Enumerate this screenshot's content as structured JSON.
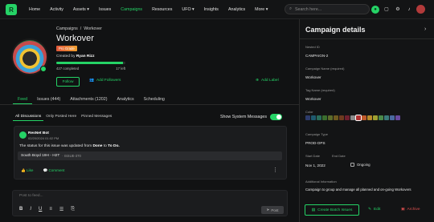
{
  "topbar": {
    "logo": "R",
    "nav": [
      "Home",
      "Activity",
      "Assets ▾",
      "Issues",
      "Campaigns",
      "Resources",
      "UFO ▾",
      "Insights",
      "Analytics",
      "More ▾"
    ],
    "active_nav": "Campaigns",
    "search_placeholder": "Search here..."
  },
  "campaign": {
    "breadcrumb_root": "Campaigns",
    "breadcrumb_sep": "/",
    "breadcrumb_current": "Workover",
    "title": "Workover",
    "status": "Pro Grade",
    "created_prefix": "Created by",
    "created_by": "Ryan Rizz",
    "progress_label": "427 completed",
    "progress_total": "17 left",
    "progress_fraction": 0.96,
    "follow_label": "Follow",
    "add_followers_label": "Add Followers",
    "add_label_label": "Add Label"
  },
  "tabs": [
    "Feed",
    "Issues (444)",
    "Attachments (1202)",
    "Analytics",
    "Scheduling"
  ],
  "active_tab": "Feed",
  "feed": {
    "subtabs": [
      "All Discussions",
      "Only Posted Here",
      "Pinned Messages"
    ],
    "show_system_label": "Show System Messages",
    "post": {
      "author": "ResNet Bot",
      "time": "02/20/2024 01:02 PM",
      "text_pre": "The status for this issue was updated from",
      "from": "Done",
      "mid": "to",
      "to": "To Do.",
      "issue_name": "South Boyd 19H - H2T",
      "issue_code": "· ISSUE-370",
      "like": "Like",
      "comment": "Comment"
    },
    "editor_placeholder": "Post to feed...",
    "post_button": "Post"
  },
  "panel": {
    "title": "Campaign details",
    "fields": [
      {
        "label": "Nested ID",
        "value": "CAMPAIGN-2"
      },
      {
        "label": "Campaign Name (required)",
        "value": "Workover"
      },
      {
        "label": "Tag Name (required)",
        "value": "Workover"
      }
    ],
    "color_label": "Color",
    "swatches": [
      "#2d3b6b",
      "#1f5a6e",
      "#2a6d5a",
      "#3a6e2e",
      "#5c6b2a",
      "#6e5a1f",
      "#6e3a1f",
      "#6e1f2e",
      "#8a8a8a",
      "#b03030",
      "#c05a2a",
      "#b88a2a",
      "#a0a030",
      "#4a8a4a",
      "#3a7a7a",
      "#4a6aa0",
      "#6a4aa0"
    ],
    "type_label": "Campaign Type",
    "type_value": "PROD-OPS",
    "start_label": "Start Date",
    "end_label": "End Date",
    "start_value": "Nov 1, 2022",
    "ongoing_label": "Ongoing",
    "info_label": "Additional Information",
    "info_value": "Campaign to group and manage all planned and on-going Workovers",
    "batch_button": "Create Batch Issues",
    "edit_button": "Edit",
    "archive_button": "Archive"
  }
}
